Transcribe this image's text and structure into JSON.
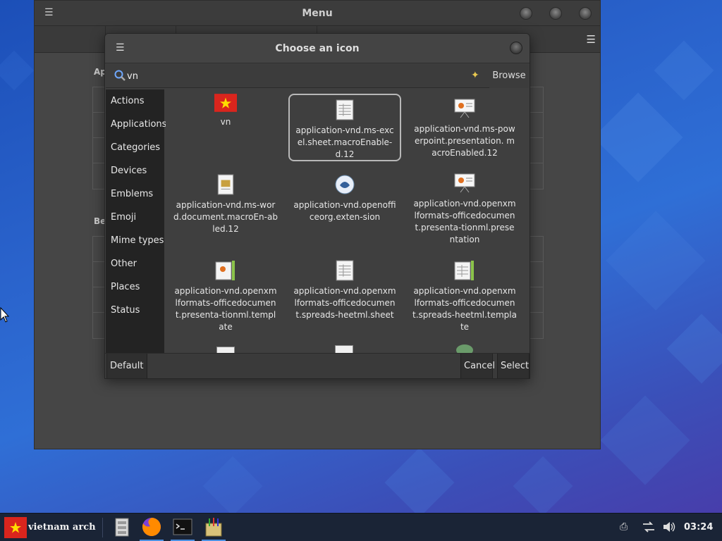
{
  "menu_window": {
    "title": "Menu",
    "section_1_label": "Ap",
    "section_2_label": "Be"
  },
  "dialog": {
    "title": "Choose an icon",
    "search": {
      "value": "vn",
      "placeholder": ""
    },
    "browse_label": "Browse",
    "categories": [
      "Actions",
      "Applications",
      "Categories",
      "Devices",
      "Emblems",
      "Emoji",
      "Mime types",
      "Other",
      "Places",
      "Status"
    ],
    "icons": [
      {
        "label": "vn",
        "icon": "vietnam-flag-icon",
        "selected": false
      },
      {
        "label": "application-vnd.ms-excel.sheet.macroEnabled.12",
        "display": "application-vnd.ms-excel.sheet.macroEnable-d.12",
        "icon": "spreadsheet-icon",
        "selected": true
      },
      {
        "label": "application-vnd.ms-powerpoint.presentation.macroEnabled.12",
        "display": "application-vnd.ms-powerpoint.presentation. macroEnabled.12",
        "icon": "presentation-icon",
        "selected": false
      },
      {
        "label": "application-vnd.ms-word.document.macroEnabled.12",
        "display": "application-vnd.ms-word.document.macroEn-abled.12",
        "icon": "document-icon",
        "selected": false
      },
      {
        "label": "application-vnd.openofficeorg.extension",
        "display": "application-vnd.openofficeorg.exten-sion",
        "icon": "extension-icon",
        "selected": false
      },
      {
        "label": "application-vnd.openxmlformats-officedocument.presentationml.presentation",
        "display": "application-vnd.openxmlformats-officedocument.presenta-tionml.presentation",
        "icon": "presentation-icon",
        "selected": false
      },
      {
        "label": "application-vnd.openxmlformats-officedocument.presentationml.template",
        "display": "application-vnd.openxmlformats-officedocument.presenta-tionml.template",
        "icon": "presentation-template-icon",
        "selected": false
      },
      {
        "label": "application-vnd.openxmlformats-officedocument.spreadsheetml.sheet",
        "display": "application-vnd.openxmlformats-officedocument.spreads-heetml.sheet",
        "icon": "spreadsheet-icon",
        "selected": false
      },
      {
        "label": "application-vnd.openxmlformats-officedocument.spreadsheetml.template",
        "display": "application-vnd.openxmlformats-officedocument.spreads-heetml.template",
        "icon": "spreadsheet-template-icon",
        "selected": false
      }
    ],
    "default_label": "Default",
    "cancel_label": "Cancel",
    "select_label": "Select"
  },
  "taskbar": {
    "start_label": "vietnam arch",
    "clock": "03:24",
    "apps": [
      "file-manager-icon",
      "firefox-icon",
      "terminal-icon",
      "text-editor-icon"
    ]
  },
  "colors": {
    "flag_red": "#da251d",
    "flag_star": "#ffde00",
    "accent": "#4a90e2"
  }
}
